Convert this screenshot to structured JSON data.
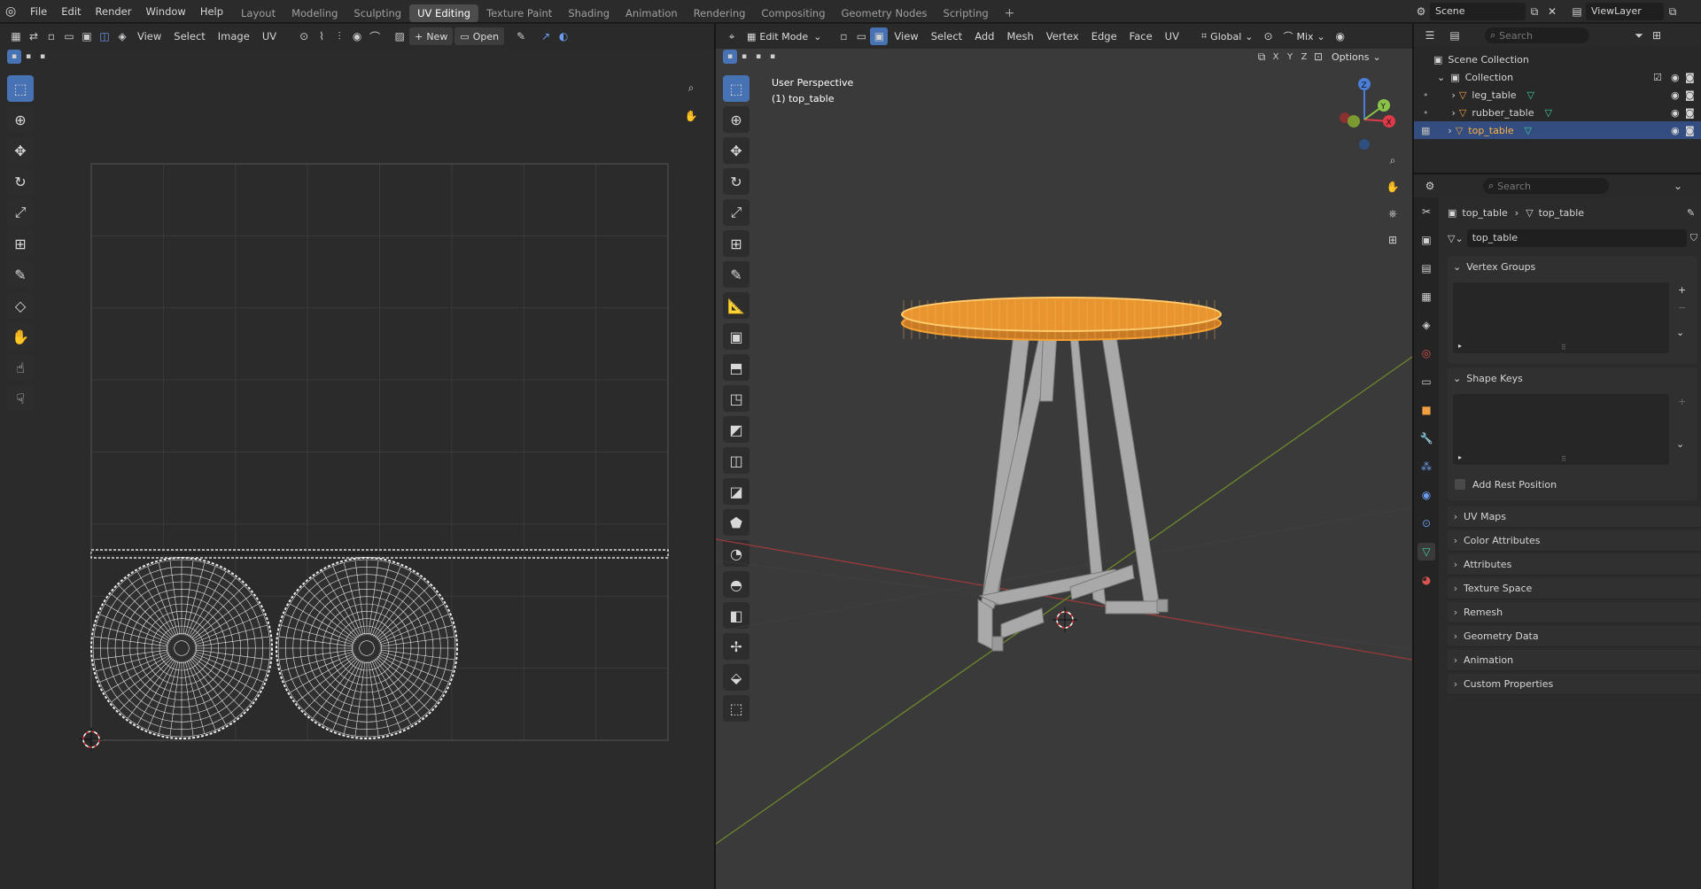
{
  "menu": {
    "items": [
      "File",
      "Edit",
      "Render",
      "Window",
      "Help"
    ]
  },
  "workspaces": {
    "tabs": [
      "Layout",
      "Modeling",
      "Sculpting",
      "UV Editing",
      "Texture Paint",
      "Shading",
      "Animation",
      "Rendering",
      "Compositing",
      "Geometry Nodes",
      "Scripting"
    ],
    "active": "UV Editing"
  },
  "scene": {
    "label": "Scene",
    "viewlayer": "ViewLayer"
  },
  "uv_editor": {
    "menus": [
      "View",
      "Select",
      "Image",
      "UV"
    ],
    "new_label": "New",
    "open_label": "Open"
  },
  "viewport": {
    "mode": "Edit Mode",
    "menus": [
      "View",
      "Select",
      "Add",
      "Mesh",
      "Vertex",
      "Edge",
      "Face",
      "UV"
    ],
    "orientation": "Global",
    "snap_label": "Mix",
    "axes": [
      "X",
      "Y",
      "Z"
    ],
    "options_label": "Options",
    "overlay_line1": "User Perspective",
    "overlay_line2": "(1) top_table"
  },
  "outliner": {
    "search_placeholder": "Search",
    "scene_collection": "Scene Collection",
    "collection": "Collection",
    "objects": [
      "leg_table",
      "rubber_table",
      "top_table"
    ],
    "selected": "top_table"
  },
  "properties": {
    "search_placeholder": "Search",
    "breadcrumb_object": "top_table",
    "breadcrumb_mesh": "top_table",
    "mesh_name": "top_table",
    "panels": {
      "vertex_groups": "Vertex Groups",
      "shape_keys": "Shape Keys",
      "add_rest_position": "Add Rest Position",
      "collapsed": [
        "UV Maps",
        "Color Attributes",
        "Attributes",
        "Texture Space",
        "Remesh",
        "Geometry Data",
        "Animation",
        "Custom Properties"
      ]
    }
  },
  "colors": {
    "accent": "#4772b3",
    "selection_orange": "#f5a030",
    "active_object": "#ffb13b"
  }
}
